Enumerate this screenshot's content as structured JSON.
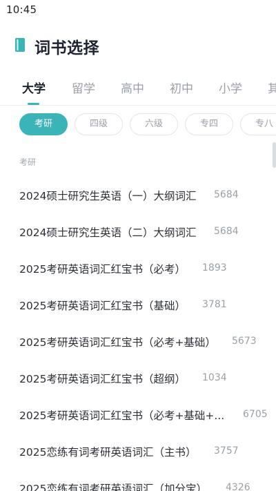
{
  "status_bar": {
    "time": "10:45"
  },
  "header": {
    "title": "词书选择",
    "icon": "book-icon",
    "icon_color": "#3bb4b8"
  },
  "tabs": [
    {
      "label": "大学",
      "active": true
    },
    {
      "label": "留学",
      "active": false
    },
    {
      "label": "高中",
      "active": false
    },
    {
      "label": "初中",
      "active": false
    },
    {
      "label": "小学",
      "active": false
    },
    {
      "label": "其",
      "active": false
    }
  ],
  "chips": [
    {
      "label": "考研",
      "active": true
    },
    {
      "label": "四级",
      "active": false
    },
    {
      "label": "六级",
      "active": false
    },
    {
      "label": "专四",
      "active": false
    },
    {
      "label": "专八",
      "active": false
    }
  ],
  "section": {
    "label": "考研"
  },
  "books": [
    {
      "name": "2024硕士研究生英语（一）大纲词汇",
      "count": "5684"
    },
    {
      "name": "2024硕士研究生英语（二）大纲词汇",
      "count": "5684"
    },
    {
      "name": "2025考研英语词汇红宝书（必考）",
      "count": "1893"
    },
    {
      "name": "2025考研英语词汇红宝书（基础）",
      "count": "3781"
    },
    {
      "name": "2025考研英语词汇红宝书（必考+基础）",
      "count": "5673"
    },
    {
      "name": "2025考研英语词汇红宝书（超纲）",
      "count": "1034"
    },
    {
      "name": "2025考研英语词汇红宝书（必考+基础+...",
      "count": "6705"
    },
    {
      "name": "2025恋练有词考研英语词汇（主书）",
      "count": "3757"
    },
    {
      "name": "2025恋练有词考研英语词汇（加分宝）",
      "count": "4326"
    }
  ],
  "colors": {
    "accent": "#3bb4b8",
    "text_primary": "#2b2f36",
    "text_secondary": "#9aa0a8"
  }
}
